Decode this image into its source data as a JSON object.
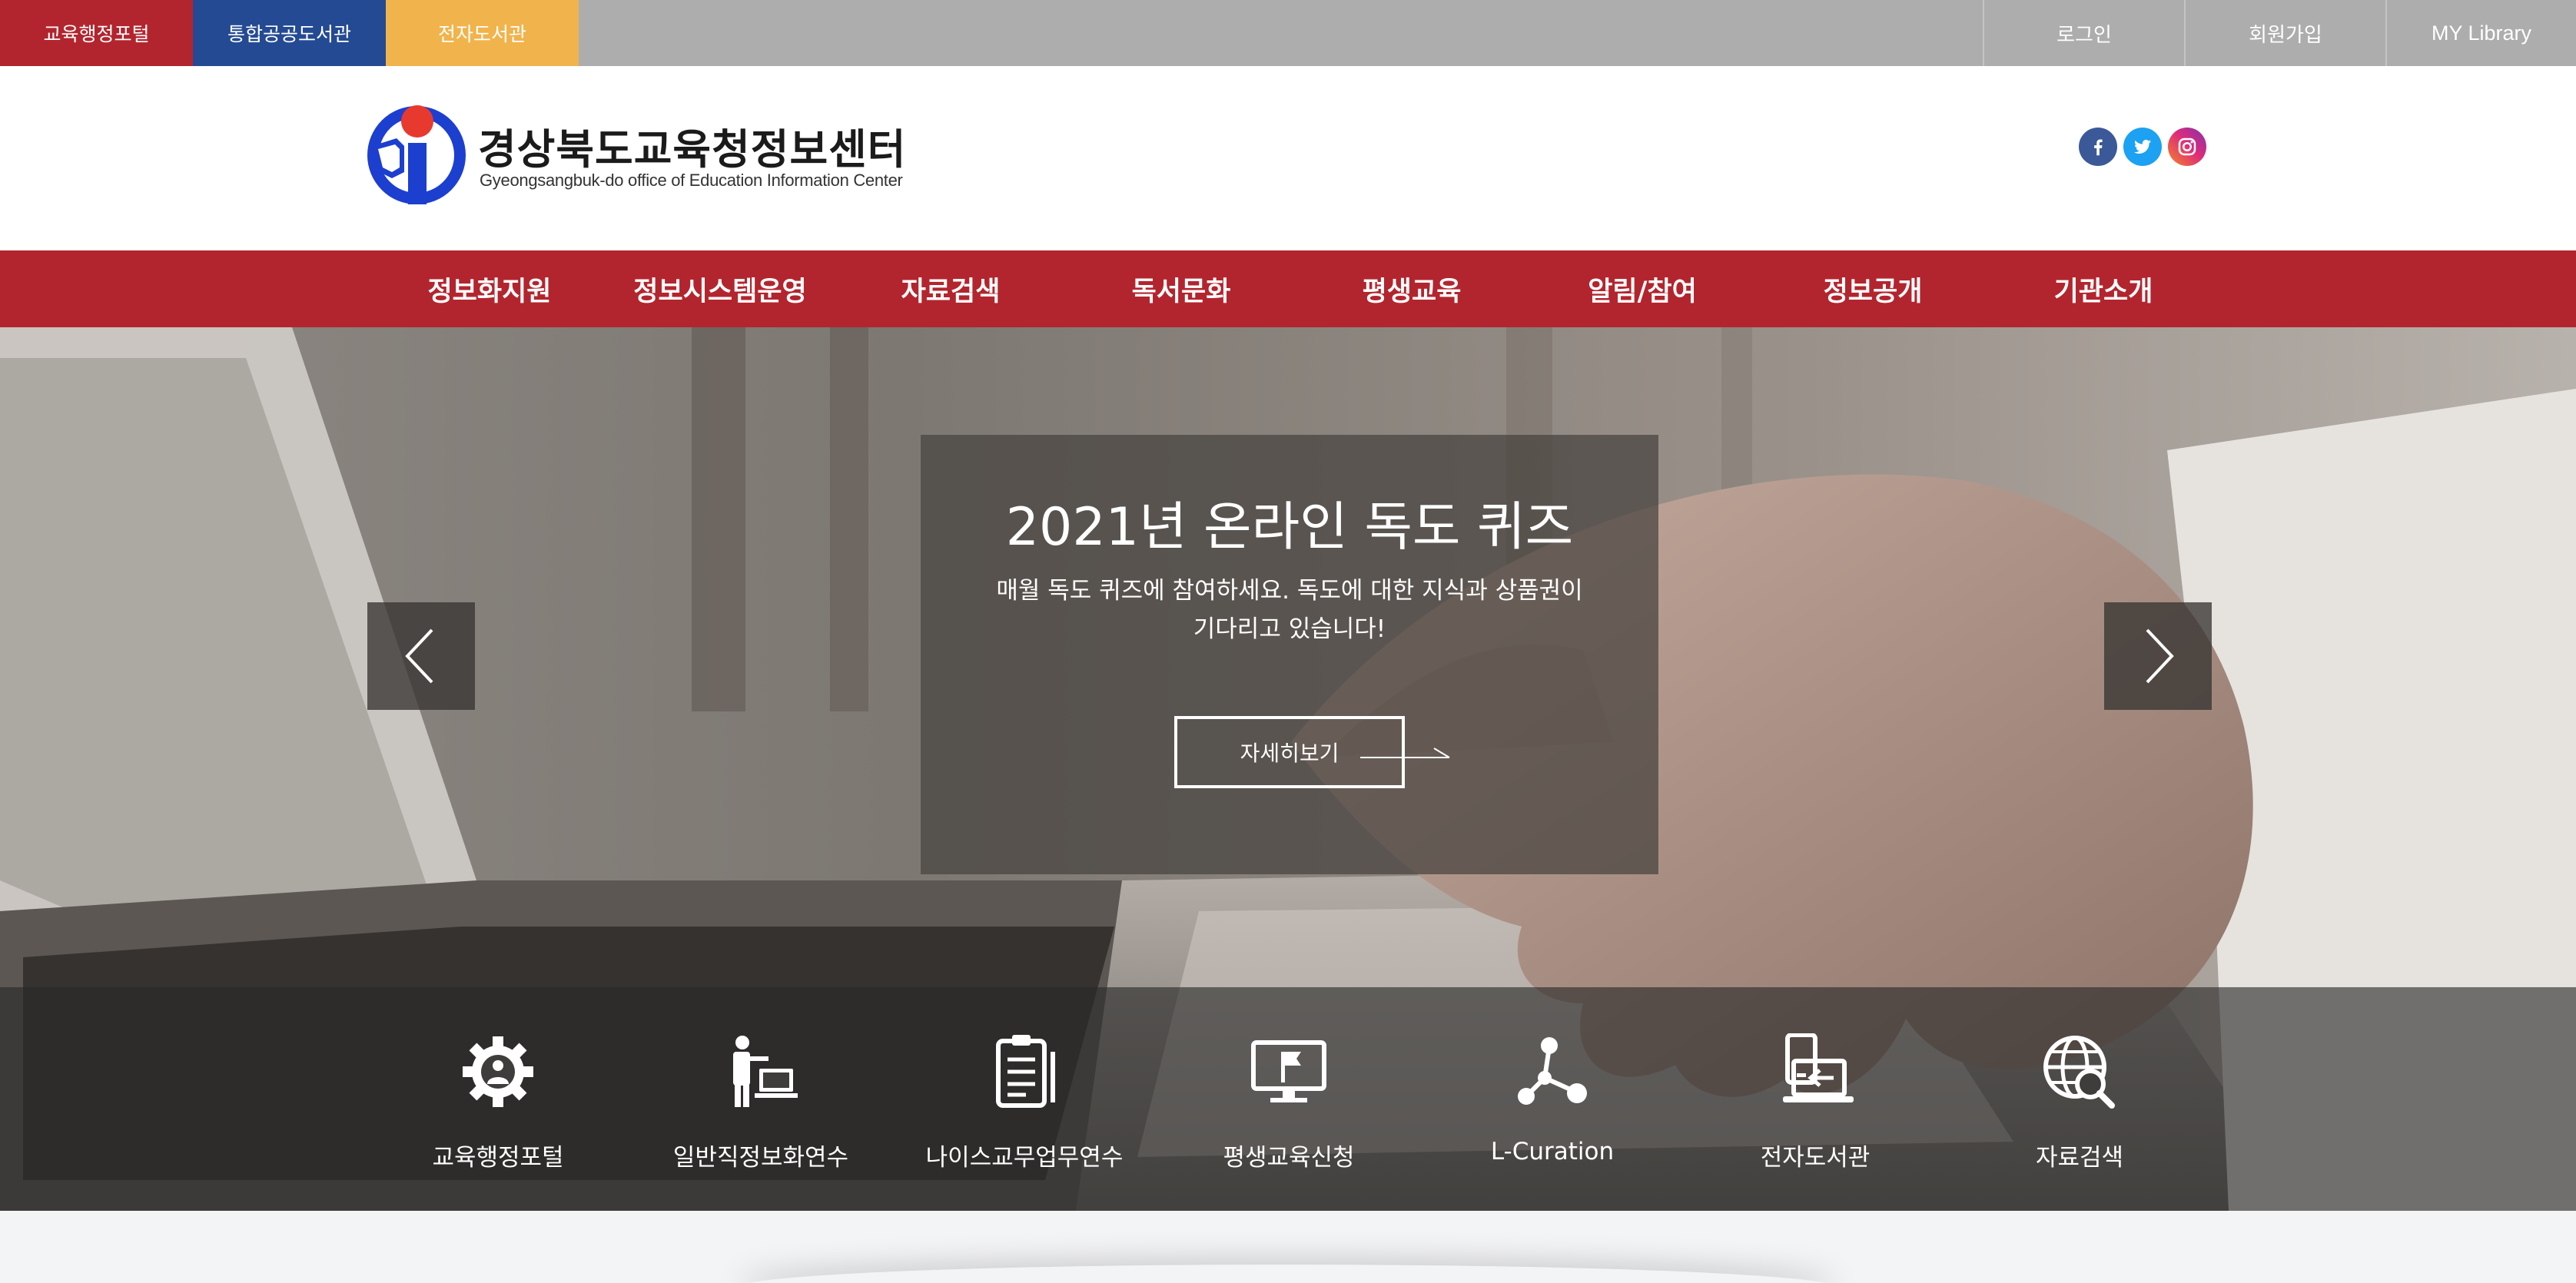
{
  "site_tabs": [
    "교육행정포털",
    "통합공공도서관",
    "전자도서관"
  ],
  "user_links": {
    "login": "로그인",
    "signup": "회원가입",
    "library": "MY Library"
  },
  "logo": {
    "title": "경상북도교육청정보센터",
    "subtitle": "Gyeongsangbuk-do office of Education Information Center"
  },
  "social": [
    "facebook-icon",
    "twitter-icon",
    "instagram-icon"
  ],
  "main_nav": [
    "정보화지원",
    "정보시스템운영",
    "자료검색",
    "독서문화",
    "평생교육",
    "알림/참여",
    "정보공개",
    "기관소개"
  ],
  "hero": {
    "title": "2021년 온라인 독도 퀴즈",
    "description": "매월 독도 퀴즈에 참여하세요. 독도에 대한 지식과 상품권이 기다리고 있습니다!",
    "button_label": "자세히보기"
  },
  "quick_links": [
    {
      "label": "교육행정포털",
      "icon": "gear-person-icon"
    },
    {
      "label": "일반직정보화연수",
      "icon": "presenter-icon"
    },
    {
      "label": "나이스교무업무연수",
      "icon": "clipboard-icon"
    },
    {
      "label": "평생교육신청",
      "icon": "monitor-flag-icon"
    },
    {
      "label": "L-Curation",
      "icon": "network-icon"
    },
    {
      "label": "전자도서관",
      "icon": "mobile-laptop-icon"
    },
    {
      "label": "자료검색",
      "icon": "globe-search-icon"
    }
  ],
  "colors": {
    "brand_red": "#b3252e",
    "brand_blue": "#244a93",
    "brand_yellow": "#f1b34b",
    "topbar_gray": "#adadad"
  }
}
